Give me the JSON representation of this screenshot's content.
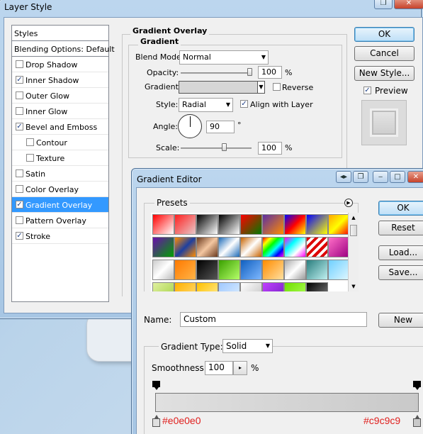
{
  "layer_style": {
    "title": "Layer Style",
    "styles": [
      {
        "label": "Styles",
        "checkbox": false,
        "checked": false,
        "indent": false,
        "selected": false,
        "header": true
      },
      {
        "label": "Blending Options: Default",
        "checkbox": false,
        "checked": false,
        "indent": false,
        "selected": false,
        "header": true
      },
      {
        "label": "Drop Shadow",
        "checkbox": true,
        "checked": false,
        "indent": false,
        "selected": false
      },
      {
        "label": "Inner Shadow",
        "checkbox": true,
        "checked": true,
        "indent": false,
        "selected": false
      },
      {
        "label": "Outer Glow",
        "checkbox": true,
        "checked": false,
        "indent": false,
        "selected": false
      },
      {
        "label": "Inner Glow",
        "checkbox": true,
        "checked": false,
        "indent": false,
        "selected": false
      },
      {
        "label": "Bevel and Emboss",
        "checkbox": true,
        "checked": true,
        "indent": false,
        "selected": false
      },
      {
        "label": "Contour",
        "checkbox": true,
        "checked": false,
        "indent": true,
        "selected": false
      },
      {
        "label": "Texture",
        "checkbox": true,
        "checked": false,
        "indent": true,
        "selected": false
      },
      {
        "label": "Satin",
        "checkbox": true,
        "checked": false,
        "indent": false,
        "selected": false
      },
      {
        "label": "Color Overlay",
        "checkbox": true,
        "checked": false,
        "indent": false,
        "selected": false
      },
      {
        "label": "Gradient Overlay",
        "checkbox": true,
        "checked": true,
        "indent": false,
        "selected": true
      },
      {
        "label": "Pattern Overlay",
        "checkbox": true,
        "checked": false,
        "indent": false,
        "selected": false
      },
      {
        "label": "Stroke",
        "checkbox": true,
        "checked": true,
        "indent": false,
        "selected": false
      }
    ],
    "section_title": "Gradient Overlay",
    "group_title": "Gradient",
    "blend_mode_label": "Blend Mode:",
    "blend_mode_value": "Normal",
    "opacity_label": "Opacity:",
    "opacity_value": "100",
    "opacity_unit": "%",
    "gradient_label": "Gradient:",
    "reverse_label": "Reverse",
    "reverse_checked": false,
    "style_label": "Style:",
    "style_value": "Radial",
    "align_label": "Align with Layer",
    "align_checked": true,
    "angle_label": "Angle:",
    "angle_value": "90",
    "angle_unit": "°",
    "scale_label": "Scale:",
    "scale_value": "100",
    "scale_unit": "%",
    "ok_label": "OK",
    "cancel_label": "Cancel",
    "new_style_label": "New Style...",
    "preview_label": "Preview",
    "preview_checked": true
  },
  "gradient_editor": {
    "title": "Gradient Editor",
    "presets_label": "Presets",
    "ok_label": "OK",
    "reset_label": "Reset",
    "load_label": "Load...",
    "save_label": "Save...",
    "name_label": "Name:",
    "name_value": "Custom",
    "new_label": "New",
    "gradient_type_label": "Gradient Type:",
    "gradient_type_value": "Solid",
    "smoothness_label": "Smoothness:",
    "smoothness_value": "100",
    "smoothness_unit": "%",
    "color_stop_left": "#e0e0e0",
    "color_stop_right": "#c9c9c9"
  }
}
